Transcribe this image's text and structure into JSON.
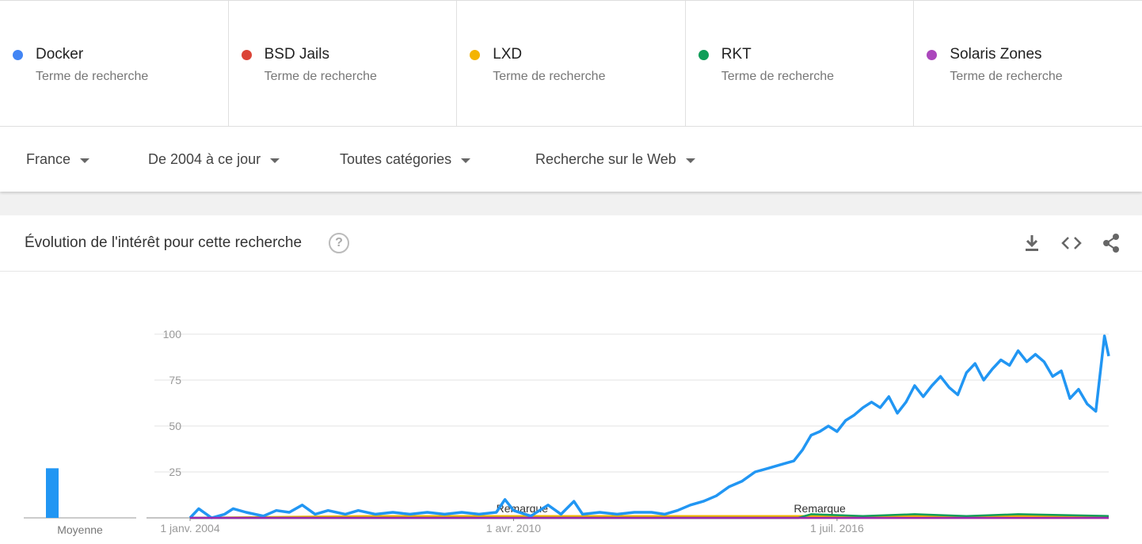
{
  "terms": [
    {
      "name": "Docker",
      "sub": "Terme de recherche",
      "color": "#4285f4"
    },
    {
      "name": "BSD Jails",
      "sub": "Terme de recherche",
      "color": "#db4437"
    },
    {
      "name": "LXD",
      "sub": "Terme de recherche",
      "color": "#f4b400"
    },
    {
      "name": "RKT",
      "sub": "Terme de recherche",
      "color": "#0f9d58"
    },
    {
      "name": "Solaris Zones",
      "sub": "Terme de recherche",
      "color": "#ab47bc"
    }
  ],
  "filters": {
    "region": "France",
    "period": "De 2004 à ce jour",
    "category": "Toutes catégories",
    "search_type": "Recherche sur le Web"
  },
  "card": {
    "title": "Évolution de l'intérêt pour cette recherche",
    "help_glyph": "?",
    "icons": [
      "download-icon",
      "embed-icon",
      "share-icon"
    ]
  },
  "chart_data": {
    "type": "line",
    "yticks": [
      "100",
      "75",
      "50",
      "25"
    ],
    "ylim": [
      0,
      100
    ],
    "xtick_labels": [
      "1 janv. 2004",
      "1 avr. 2010",
      "1 juil. 2016"
    ],
    "xtick_dates": [
      "2004-01",
      "2010-04",
      "2016-07"
    ],
    "xrange": [
      "2004-01",
      "2021-10"
    ],
    "annotations": [
      {
        "label": "Remarque",
        "date": "2010-06"
      },
      {
        "label": "Remarque",
        "date": "2016-03"
      }
    ],
    "average_label": "Moyenne",
    "averages": [
      {
        "name": "Docker",
        "value": 27
      }
    ],
    "series": [
      {
        "name": "Docker",
        "color": "#2196f3",
        "points": [
          [
            "2004-01",
            0
          ],
          [
            "2004-03",
            5
          ],
          [
            "2004-06",
            0
          ],
          [
            "2004-09",
            2
          ],
          [
            "2004-11",
            5
          ],
          [
            "2005-02",
            3
          ],
          [
            "2005-06",
            1
          ],
          [
            "2005-09",
            4
          ],
          [
            "2005-12",
            3
          ],
          [
            "2006-03",
            7
          ],
          [
            "2006-06",
            2
          ],
          [
            "2006-09",
            4
          ],
          [
            "2007-01",
            2
          ],
          [
            "2007-04",
            4
          ],
          [
            "2007-08",
            2
          ],
          [
            "2007-12",
            3
          ],
          [
            "2008-04",
            2
          ],
          [
            "2008-08",
            3
          ],
          [
            "2008-12",
            2
          ],
          [
            "2009-04",
            3
          ],
          [
            "2009-08",
            2
          ],
          [
            "2009-12",
            3
          ],
          [
            "2010-02",
            10
          ],
          [
            "2010-04",
            4
          ],
          [
            "2010-08",
            1
          ],
          [
            "2010-12",
            7
          ],
          [
            "2011-03",
            2
          ],
          [
            "2011-06",
            9
          ],
          [
            "2011-08",
            2
          ],
          [
            "2011-12",
            3
          ],
          [
            "2012-04",
            2
          ],
          [
            "2012-08",
            3
          ],
          [
            "2012-12",
            3
          ],
          [
            "2013-03",
            2
          ],
          [
            "2013-06",
            4
          ],
          [
            "2013-09",
            7
          ],
          [
            "2013-12",
            9
          ],
          [
            "2014-03",
            12
          ],
          [
            "2014-06",
            17
          ],
          [
            "2014-09",
            20
          ],
          [
            "2014-12",
            25
          ],
          [
            "2015-03",
            27
          ],
          [
            "2015-06",
            29
          ],
          [
            "2015-09",
            31
          ],
          [
            "2015-11",
            37
          ],
          [
            "2016-01",
            45
          ],
          [
            "2016-03",
            47
          ],
          [
            "2016-05",
            50
          ],
          [
            "2016-07",
            47
          ],
          [
            "2016-09",
            53
          ],
          [
            "2016-11",
            56
          ],
          [
            "2017-01",
            60
          ],
          [
            "2017-03",
            63
          ],
          [
            "2017-05",
            60
          ],
          [
            "2017-07",
            66
          ],
          [
            "2017-09",
            57
          ],
          [
            "2017-11",
            63
          ],
          [
            "2018-01",
            72
          ],
          [
            "2018-03",
            66
          ],
          [
            "2018-05",
            72
          ],
          [
            "2018-07",
            77
          ],
          [
            "2018-09",
            71
          ],
          [
            "2018-11",
            67
          ],
          [
            "2019-01",
            79
          ],
          [
            "2019-03",
            84
          ],
          [
            "2019-05",
            75
          ],
          [
            "2019-07",
            81
          ],
          [
            "2019-09",
            86
          ],
          [
            "2019-11",
            83
          ],
          [
            "2020-01",
            91
          ],
          [
            "2020-03",
            85
          ],
          [
            "2020-05",
            89
          ],
          [
            "2020-07",
            85
          ],
          [
            "2020-09",
            77
          ],
          [
            "2020-11",
            80
          ],
          [
            "2021-01",
            65
          ],
          [
            "2021-03",
            70
          ],
          [
            "2021-05",
            62
          ],
          [
            "2021-07",
            58
          ],
          [
            "2021-09",
            99
          ],
          [
            "2021-10",
            88
          ]
        ]
      },
      {
        "name": "BSD Jails",
        "color": "#db4437",
        "points": [
          [
            "2004-01",
            0
          ],
          [
            "2021-10",
            0
          ]
        ]
      },
      {
        "name": "LXD",
        "color": "#f4b400",
        "points": [
          [
            "2004-01",
            0
          ],
          [
            "2007-06",
            1
          ],
          [
            "2013-01",
            1
          ],
          [
            "2016-01",
            1
          ],
          [
            "2021-10",
            1
          ]
        ]
      },
      {
        "name": "RKT",
        "color": "#0f9d58",
        "points": [
          [
            "2004-01",
            0
          ],
          [
            "2015-10",
            0
          ],
          [
            "2016-01",
            2
          ],
          [
            "2017-01",
            1
          ],
          [
            "2018-01",
            2
          ],
          [
            "2019-01",
            1
          ],
          [
            "2020-01",
            2
          ],
          [
            "2021-10",
            1
          ]
        ]
      },
      {
        "name": "Solaris Zones",
        "color": "#9c27b0",
        "points": [
          [
            "2004-01",
            0
          ],
          [
            "2021-10",
            0
          ]
        ]
      }
    ]
  }
}
